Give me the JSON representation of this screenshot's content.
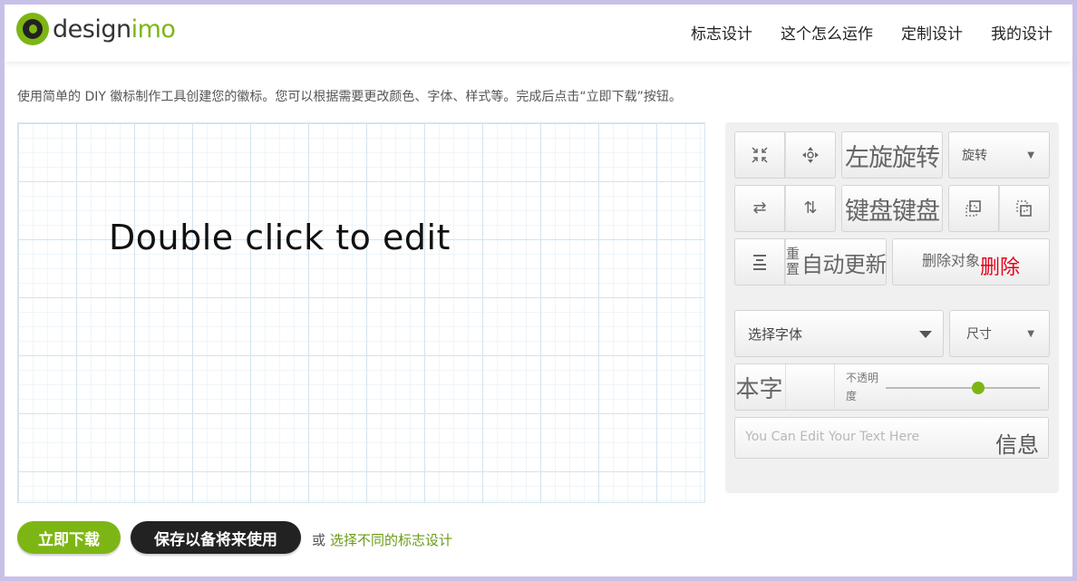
{
  "header": {
    "logo_prefix": "design",
    "logo_suffix": "imo",
    "nav": [
      "标志设计",
      "这个怎么运作",
      "定制设计",
      "我的设计"
    ]
  },
  "intro": "使用简单的 DIY 徽标制作工具创建您的徽标。您可以根据需要更改颜色、字体、样式等。完成后点击“立即下载”按钮。",
  "canvas": {
    "text": "Double click to edit"
  },
  "panel": {
    "rotate_left_text": "左旋旋转",
    "rotate_select": "旋转",
    "keyboard_text": "键盘键盘",
    "reset_label": "重置",
    "auto_update": "自动更新",
    "delete_object": "删除对象",
    "delete": "删除",
    "font_select": "选择字体",
    "size_select": "尺寸",
    "text_style": "本字",
    "opacity_label": "不透明度",
    "opacity": 0.6,
    "text_placeholder": "You Can Edit Your Text Here",
    "info": "信息"
  },
  "footer": {
    "download": "立即下载",
    "save": "保存以备将来使用",
    "or": "或",
    "alt_link": "选择不同的标志设计"
  },
  "colors": {
    "accent": "#7db614",
    "dark": "#222222",
    "delete_red": "#e3001b",
    "frame": "#c8c0e6"
  }
}
